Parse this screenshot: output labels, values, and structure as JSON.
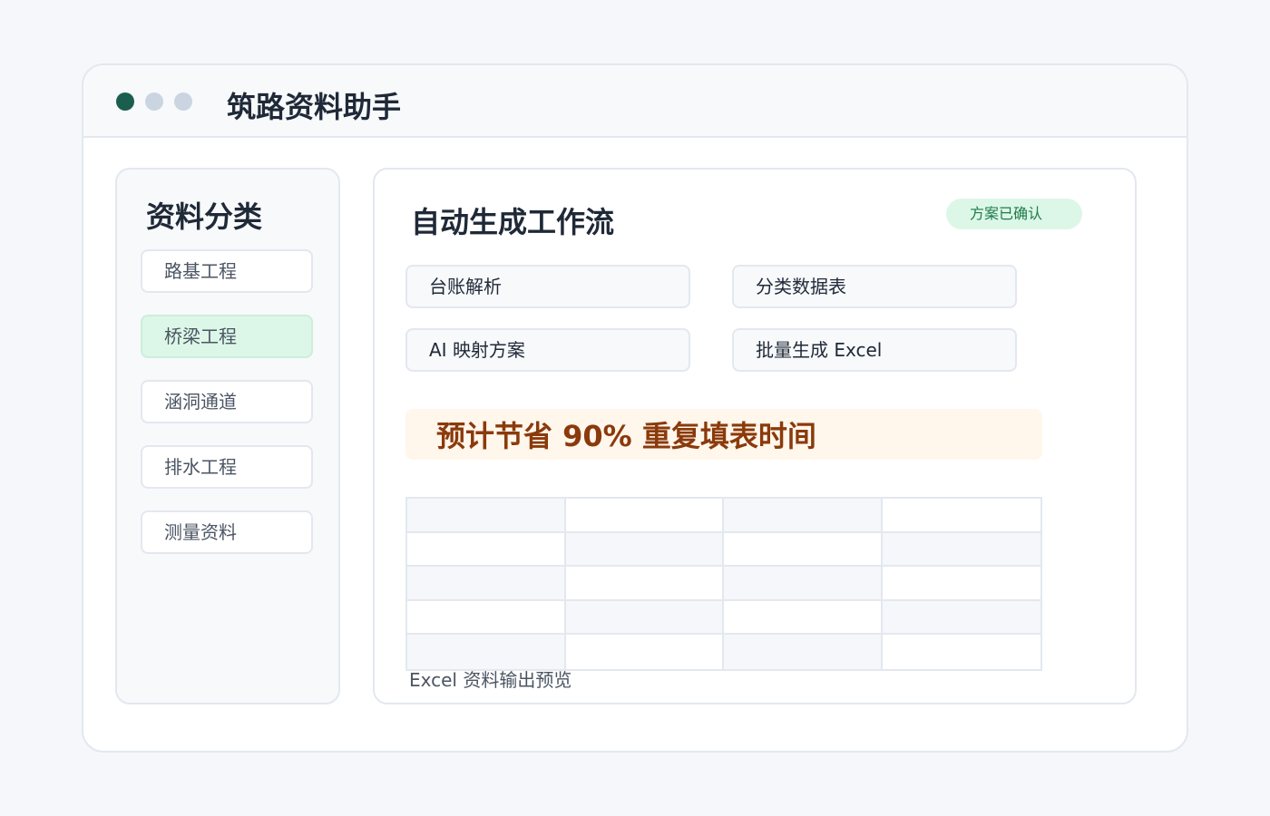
{
  "window": {
    "title": "筑路资料助手"
  },
  "sidebar": {
    "title": "资料分类",
    "items": [
      {
        "label": "路基工程",
        "active": false
      },
      {
        "label": "桥梁工程",
        "active": true
      },
      {
        "label": "涵洞通道",
        "active": false
      },
      {
        "label": "排水工程",
        "active": false
      },
      {
        "label": "测量资料",
        "active": false
      }
    ]
  },
  "main": {
    "title": "自动生成工作流",
    "status_badge": "方案已确认",
    "steps": [
      "台账解析",
      "分类数据表",
      "AI 映射方案",
      "批量生成 Excel"
    ],
    "banner": "预计节省 90% 重复填表时间",
    "preview": {
      "columns": 4,
      "rows": 5,
      "caption": "Excel 资料输出预览"
    }
  },
  "colors": {
    "accent": "#1b5e4f",
    "active_bg": "#dcf7e7",
    "badge_text": "#1f7a4a",
    "banner_bg": "#fff6ec",
    "banner_text": "#8a3a0b",
    "border": "#e3e8ef"
  }
}
